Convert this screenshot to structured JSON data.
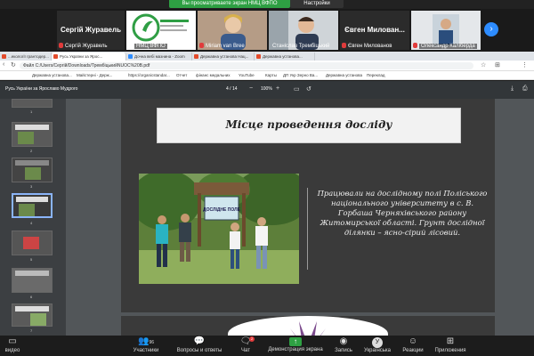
{
  "zoom": {
    "share_banner": "Вы просматриваете экран НМЦ ВФПО",
    "view_settings": "Настройки просмотра",
    "participants": [
      {
        "big": "Сергій Журавель",
        "small": "Сергій Журавель"
      },
      {
        "big": "",
        "small": "НМЦ ВФПО"
      },
      {
        "big": "",
        "small": "Miriam van Bree"
      },
      {
        "big": "",
        "small": "Станіслав Трембіцький"
      },
      {
        "big": "Євген Милован...",
        "small": "Євген Милованов"
      },
      {
        "big": "",
        "small": "Олександр Каліберда"
      }
    ],
    "logo_text": "ОРГАНІЧНЕ ВИРОБНИЦТВО",
    "next_arrow": "›",
    "bottom": {
      "video": "видео",
      "participants": "Участники",
      "participants_count": "96",
      "qa": "Вопросы и ответы",
      "chat": "Чат",
      "chat_badge": "2",
      "share": "Демонстрация экрана",
      "record": "Запись",
      "lang": "Українська",
      "lang_letter": "У",
      "reactions": "Реакции",
      "apps": "Приложения"
    }
  },
  "browser": {
    "tabs": [
      "...екології грантодер...",
      "Русь України за Ярос...",
      "Дочна вебі мазнина - Zoom",
      "Державна установа Нац...",
      "Державна установа..."
    ],
    "url": "Файл  C:/Users/Сергій/Downloads/ТрембіцькийNUOC%20B.pdf",
    "bookmarks": [
      "Державна установа...",
      "Майстерні - Держ...",
      "https://organicstandar...",
      "Отчет",
      "фінанс медальних",
      "YouTube",
      "Карты",
      "ДП Укр Зерно Ва...",
      "Державна установа",
      "Переклад"
    ]
  },
  "pdf": {
    "title": "Русь України за Ярославо Мудрого",
    "page": "4 / 14",
    "zoom": "100%",
    "thumb_numbers": [
      "1",
      "2",
      "3",
      "4",
      "5",
      "6",
      "7",
      "8"
    ],
    "slide_title": "Місце проведення досліду",
    "sign_text": "ДОСЛІДНЕ ПОЛЕ",
    "body_text": "Працювали на дослідному полі Поліського національного університету в с. В. Горбаша Черняхівського району Житомирської області. Грунт дослідної ділянки – ясно-сірий лісовий."
  }
}
